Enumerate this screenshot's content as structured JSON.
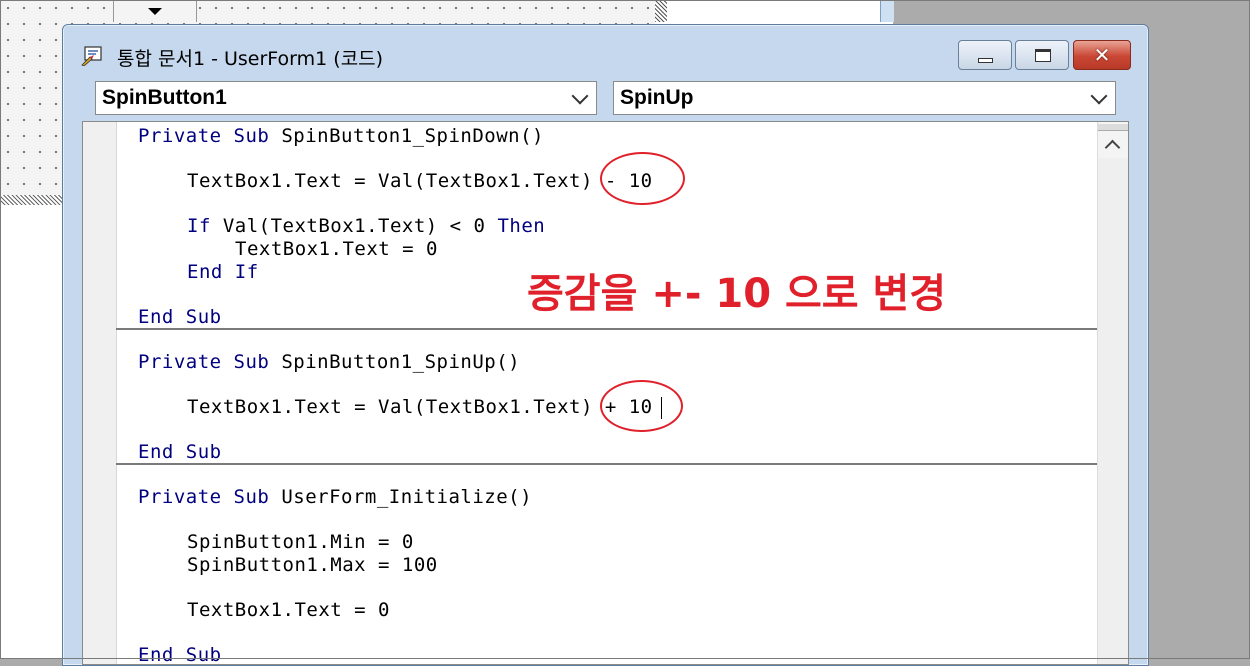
{
  "window": {
    "title": "통합 문서1 - UserForm1 (코드)",
    "icon": "vba-code-icon",
    "buttons": {
      "minimize": "minimize-icon",
      "maximize": "maximize-icon",
      "close_label": "✕"
    }
  },
  "object_combo": {
    "value": "SpinButton1"
  },
  "procedure_combo": {
    "value": "SpinUp"
  },
  "code": {
    "sub1": {
      "decl_kw1": "Private",
      "decl_kw2": "Sub",
      "decl_name": "SpinButton1_SpinDown()",
      "stmt": "TextBox1.Text = Val(TextBox1.Text) - 10",
      "if_kw": "If",
      "if_cond": "Val(TextBox1.Text) < 0",
      "then_kw": "Then",
      "if_body": "TextBox1.Text = 0",
      "endif_kw": "End If",
      "end_kw": "End Sub"
    },
    "sub2": {
      "decl_kw1": "Private",
      "decl_kw2": "Sub",
      "decl_name": "SpinButton1_SpinUp()",
      "stmt": "TextBox1.Text = Val(TextBox1.Text) + 10",
      "end_kw": "End Sub"
    },
    "sub3": {
      "decl_kw1": "Private",
      "decl_kw2": "Sub",
      "decl_name": "UserForm_Initialize()",
      "stmt1": "SpinButton1.Min = 0",
      "stmt2": "SpinButton1.Max = 100",
      "stmt3": "TextBox1.Text = 0",
      "end_kw": "End Sub"
    }
  },
  "annotation": {
    "text": "증감을 +- 10 으로 변경",
    "color": "#e0212b"
  },
  "colors": {
    "keyword": "#000080",
    "titlebar": "#c5d8ee",
    "close_button": "#c94634"
  }
}
